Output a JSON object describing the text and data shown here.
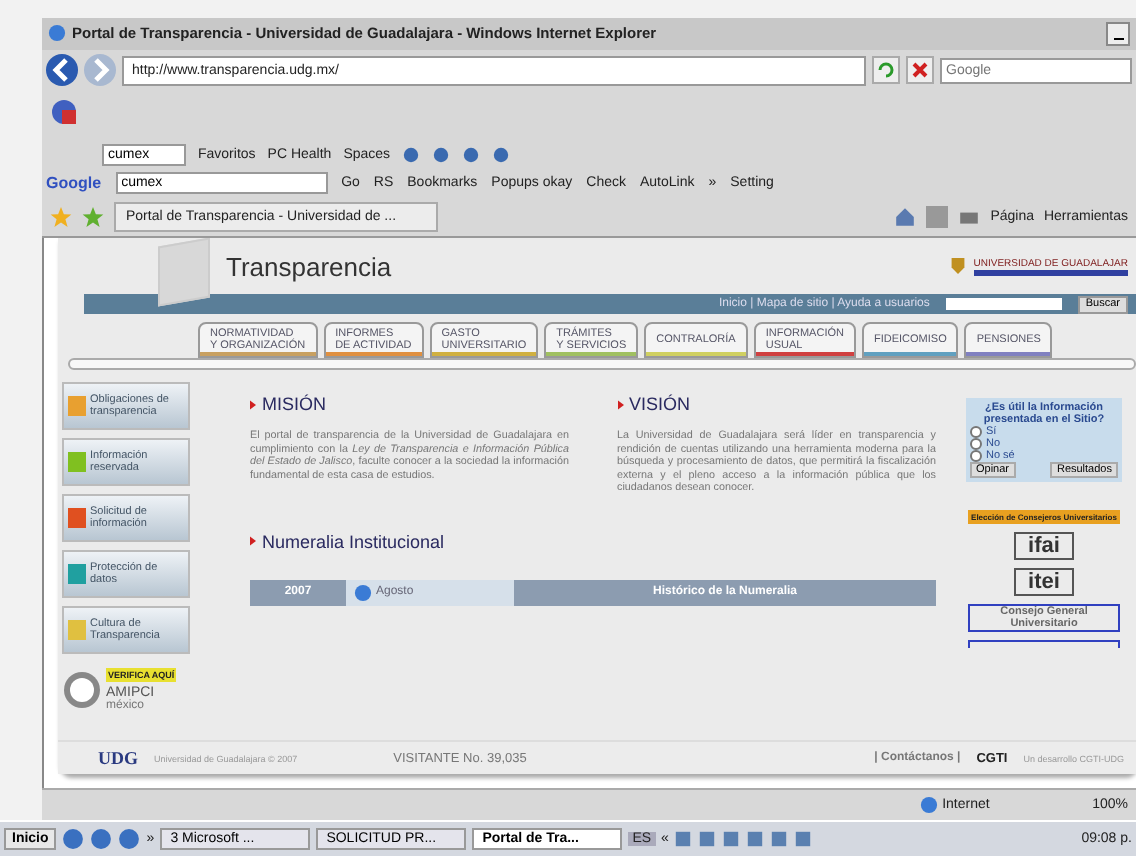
{
  "window": {
    "title": "Portal de Transparencia - Universidad de Guadalajara - Windows Internet Explorer"
  },
  "address_bar": {
    "url": "http://www.transparencia.udg.mx/",
    "search_placeholder": "Google"
  },
  "toolbar": {
    "search_value": "cumex",
    "items": [
      "Favoritos",
      "PC Health",
      "Spaces"
    ]
  },
  "google_toolbar": {
    "logo": "Google",
    "search_value": "cumex",
    "items": [
      "Go",
      "RS",
      "Bookmarks",
      "Popups okay",
      "Check",
      "AutoLink",
      "»",
      "Setting"
    ]
  },
  "tab_bar": {
    "tab": "Portal de Transparencia - Universidad de ...",
    "commands": [
      "Página",
      "Herramientas"
    ]
  },
  "page": {
    "site_title": "Transparencia",
    "university_logo": "UNIVERSIDAD DE GUADALAJAR",
    "nav_links": "Inicio | Mapa de sitio | Ayuda a usuarios",
    "search_button": "Buscar",
    "tabs": [
      {
        "label": "NORMATIVIDAD\nY ORGANIZACIÓN",
        "color": "#c8a060"
      },
      {
        "label": "INFORMES\nDE ACTIVIDAD",
        "color": "#e09040"
      },
      {
        "label": "GASTO\nUNIVERSITARIO",
        "color": "#d0b040"
      },
      {
        "label": "TRÁMITES\nY SERVICIOS",
        "color": "#a0c060"
      },
      {
        "label": "CONTRALORÍA",
        "color": "#d0d060"
      },
      {
        "label": "INFORMACIÓN\nUSUAL",
        "color": "#d04040"
      },
      {
        "label": "FIDEICOMISO",
        "color": "#60a0c0"
      },
      {
        "label": "PENSIONES",
        "color": "#8080c0"
      }
    ],
    "sidebar": [
      {
        "label": "Obligaciones de transparencia",
        "color": "#e8a030"
      },
      {
        "label": "Información reservada",
        "color": "#80c020"
      },
      {
        "label": "Solicitud de información",
        "color": "#e05020"
      },
      {
        "label": "Protección de datos",
        "color": "#20a0a0"
      },
      {
        "label": "Cultura de Transparencia",
        "color": "#e0c040"
      }
    ],
    "badge": {
      "top": "VERIFICA AQUÍ",
      "name": "AMIPCI",
      "country": "méxico"
    },
    "mission": {
      "title": "MISIÓN",
      "text": "El portal de transparencia de la Universidad de Guadalajara en cumplimiento con la *Ley de Transparencia e Información Pública del Estado de Jalisco*, faculte conocer a la sociedad la información fundamental de esta casa de estudios."
    },
    "vision": {
      "title": "VISIÓN",
      "text": "La Universidad de Guadalajara será líder en transparencia y rendición de cuentas utilizando una herramienta moderna para la búsqueda y procesamiento de datos, que permitirá la fiscalización externa y el pleno acceso a la información pública que los ciudadanos desean conocer."
    },
    "numeralia": {
      "title": "Numeralia Institucional",
      "year": "2007",
      "month": "Agosto",
      "history": "Histórico de la Numeralia"
    },
    "poll": {
      "question": "¿Es útil la Información presentada en el Sitio?",
      "options": [
        {
          "label": "Sí",
          "selected": false
        },
        {
          "label": "No",
          "selected": false
        },
        {
          "label": "No sé",
          "selected": false
        }
      ],
      "buttons": [
        "Opinar",
        "Resultados"
      ]
    },
    "banner": "Elección de Consejeros Universitarios",
    "logos": [
      "ifai",
      "itei"
    ],
    "council_link": "Consejo General Universitario",
    "footer": {
      "logo": "UDG",
      "copyright": "Universidad de Guadalajara © 2007",
      "visitor": "VISITANTE No. 39,035",
      "contact": "| Contáctanos |",
      "brand": "CGTI",
      "credit": "Un desarrollo CGTI-UDG"
    }
  },
  "status_bar": {
    "zone": "Internet",
    "zoom": "100%"
  },
  "taskbar": {
    "start": "Inicio",
    "more": "»",
    "buttons": [
      {
        "label": "3 Microsoft ...",
        "selected": false
      },
      {
        "label": "SOLICITUD PR...",
        "selected": false
      },
      {
        "label": "Portal de Tra...",
        "selected": true
      }
    ],
    "language": "ES",
    "expand": "«",
    "clock": "09:08 p."
  }
}
